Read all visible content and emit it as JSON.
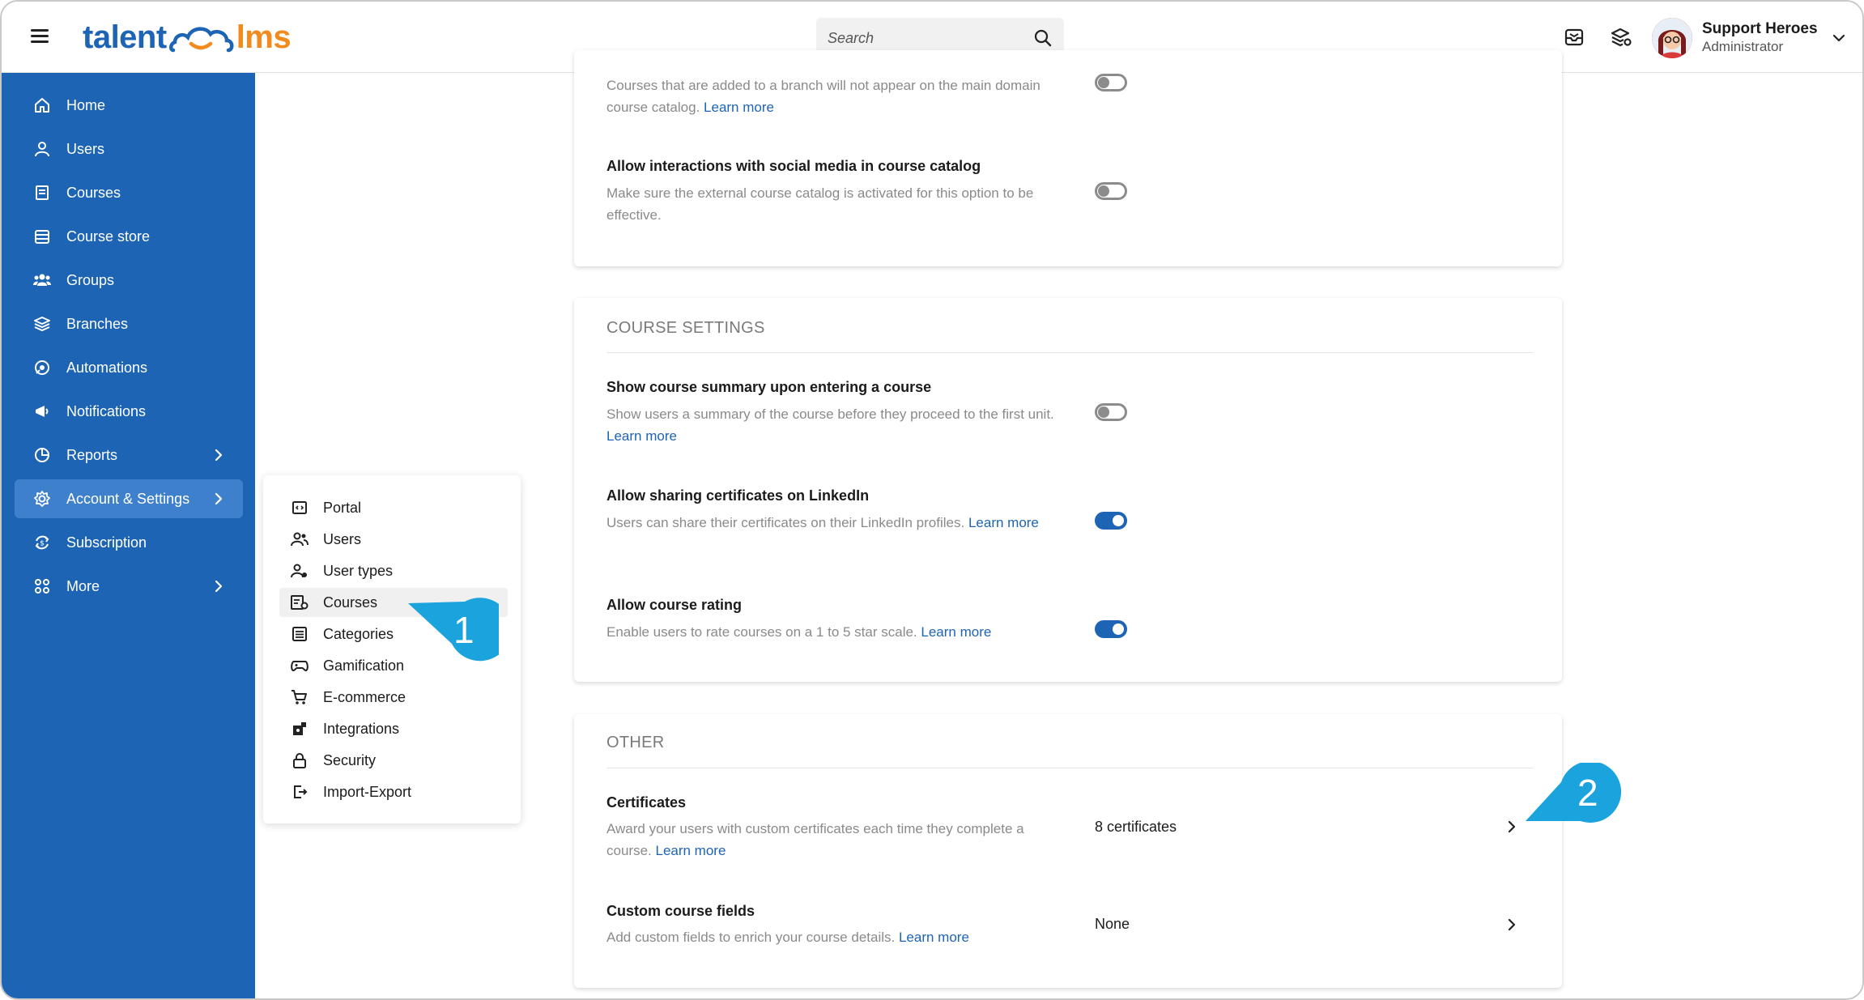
{
  "header": {
    "logo": {
      "part1": "talent",
      "part2": "lms"
    },
    "search": {
      "placeholder": "Search"
    },
    "user": {
      "name": "Support Heroes",
      "role": "Administrator"
    }
  },
  "sidebar": {
    "items": [
      {
        "label": "Home",
        "icon": "home-icon"
      },
      {
        "label": "Users",
        "icon": "user-icon"
      },
      {
        "label": "Courses",
        "icon": "book-icon"
      },
      {
        "label": "Course store",
        "icon": "store-icon"
      },
      {
        "label": "Groups",
        "icon": "groups-icon"
      },
      {
        "label": "Branches",
        "icon": "layers-icon"
      },
      {
        "label": "Automations",
        "icon": "automation-icon"
      },
      {
        "label": "Notifications",
        "icon": "megaphone-icon"
      },
      {
        "label": "Reports",
        "icon": "pie-chart-icon"
      },
      {
        "label": "Account & Settings",
        "icon": "gear-icon"
      },
      {
        "label": "Subscription",
        "icon": "subscription-icon"
      },
      {
        "label": "More",
        "icon": "grid-icon"
      }
    ]
  },
  "submenu": {
    "items": [
      {
        "label": "Portal",
        "icon": "portal-icon"
      },
      {
        "label": "Users",
        "icon": "users-icon"
      },
      {
        "label": "User types",
        "icon": "user-types-icon"
      },
      {
        "label": "Courses",
        "icon": "courses-settings-icon"
      },
      {
        "label": "Categories",
        "icon": "list-icon"
      },
      {
        "label": "Gamification",
        "icon": "gamepad-icon"
      },
      {
        "label": "E-commerce",
        "icon": "cart-icon"
      },
      {
        "label": "Integrations",
        "icon": "puzzle-icon"
      },
      {
        "label": "Security",
        "icon": "lock-icon"
      },
      {
        "label": "Import-Export",
        "icon": "import-export-icon"
      }
    ]
  },
  "card_catalog": {
    "row1": {
      "desc": "Courses that are added to a branch will not appear on the main domain course catalog.",
      "link": "Learn more",
      "enabled": false
    },
    "row2": {
      "title": "Allow interactions with social media in course catalog",
      "desc": "Make sure the external course catalog is activated for this option to be effective.",
      "enabled": false
    }
  },
  "card_course_settings": {
    "heading": "COURSE SETTINGS",
    "row1": {
      "title": "Show course summary upon entering a course",
      "desc": "Show users a summary of the course before they proceed to the first unit.",
      "link": "Learn more",
      "enabled": false
    },
    "row2": {
      "title": "Allow sharing certificates on LinkedIn",
      "desc": "Users can share their certificates on their LinkedIn profiles.",
      "link": "Learn more",
      "enabled": true
    },
    "row3": {
      "title": "Allow course rating",
      "desc": "Enable users to rate courses on a 1 to 5 star scale.",
      "link": "Learn more",
      "enabled": true
    }
  },
  "card_other": {
    "heading": "OTHER",
    "row1": {
      "title": "Certificates",
      "desc": "Award your users with custom certificates each time they complete a course.",
      "link": "Learn more",
      "value": "8 certificates"
    },
    "row2": {
      "title": "Custom course fields",
      "desc": "Add custom fields to enrich your course details.",
      "link": "Learn more",
      "value": "None"
    }
  },
  "callouts": {
    "one": "1",
    "two": "2"
  },
  "colors": {
    "brand_blue": "#1d64b5",
    "brand_orange": "#f28a1e",
    "callout_blue": "#1aa3dc"
  }
}
